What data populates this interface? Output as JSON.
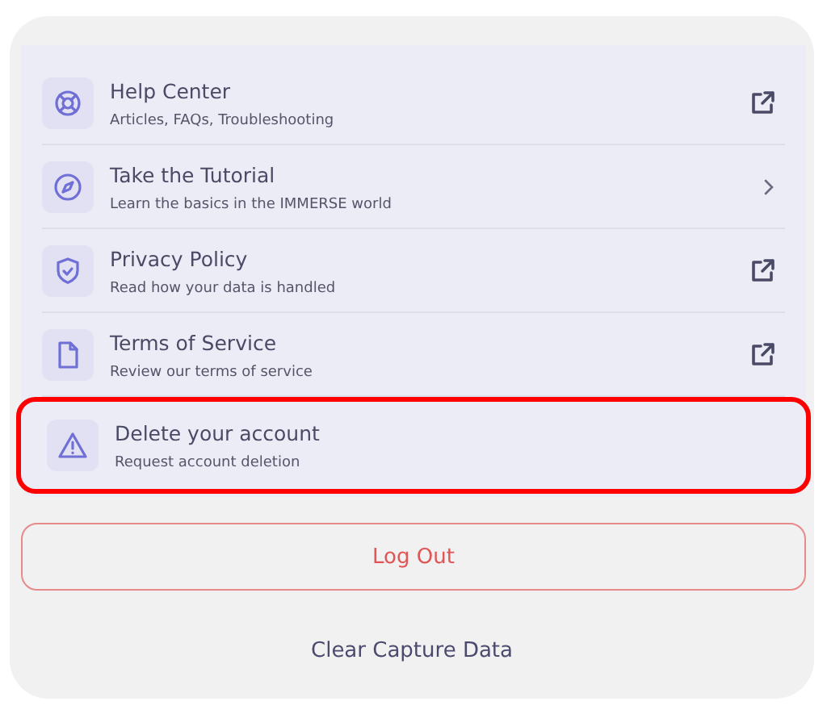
{
  "menu_items": [
    {
      "kind": "external",
      "title": "Help Center",
      "subtitle": "Articles, FAQs, Troubleshooting",
      "highlighted": false
    },
    {
      "kind": "chevron",
      "title": "Take the Tutorial",
      "subtitle": "Learn the basics in the IMMERSE world",
      "highlighted": false
    },
    {
      "kind": "external",
      "title": "Privacy Policy",
      "subtitle": "Read how your data is handled",
      "highlighted": false
    },
    {
      "kind": "external",
      "title": "Terms of Service",
      "subtitle": "Review our terms of service",
      "highlighted": false
    },
    {
      "kind": "plain",
      "title": "Delete your account",
      "subtitle": "Request account deletion",
      "highlighted": true
    }
  ],
  "logout_button": "Log Out",
  "clear_link": "Clear Capture Data"
}
